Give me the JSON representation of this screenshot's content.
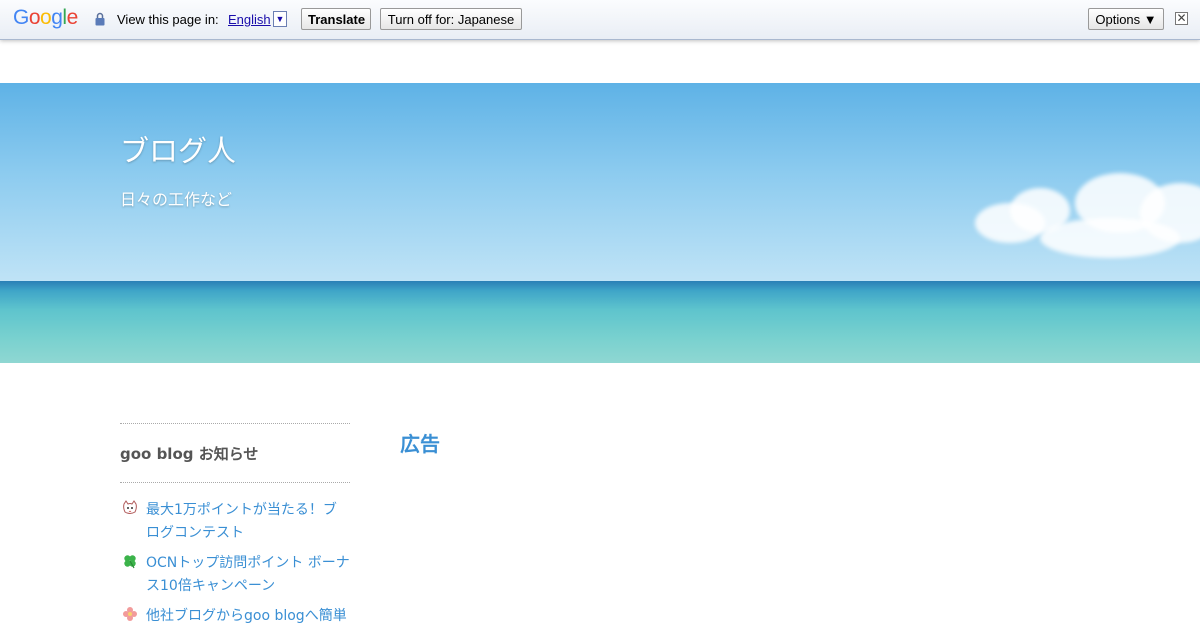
{
  "translate_bar": {
    "logo": "Google",
    "view_label": "View this page in:",
    "language": "English",
    "language_arrow": "▼",
    "translate_button": "Translate",
    "turn_off_button": "Turn off for: Japanese",
    "options_button": "Options ▼",
    "close_glyph": "✕"
  },
  "header": {
    "blog_title": "ブログ人",
    "blog_subtitle": "日々の工作など"
  },
  "sidebar": {
    "heading": "goo blog お知らせ",
    "items": [
      {
        "label": "最大1万ポイントが当たる！ブログコンテスト",
        "icon": "cat-face-icon"
      },
      {
        "label": "OCNトップ訪問ポイント ボーナス10倍キャンペーン",
        "icon": "clover-icon"
      },
      {
        "label": "他社ブログからgoo blogへ簡単",
        "icon": "flower-icon"
      }
    ]
  },
  "main": {
    "ad_heading": "広告"
  },
  "colors": {
    "link": "#3a8fd4",
    "heading_gray": "#555555",
    "google_blue": "#4285f4",
    "google_red": "#ea4335",
    "google_yellow": "#fbbc05",
    "google_green": "#34a853"
  }
}
